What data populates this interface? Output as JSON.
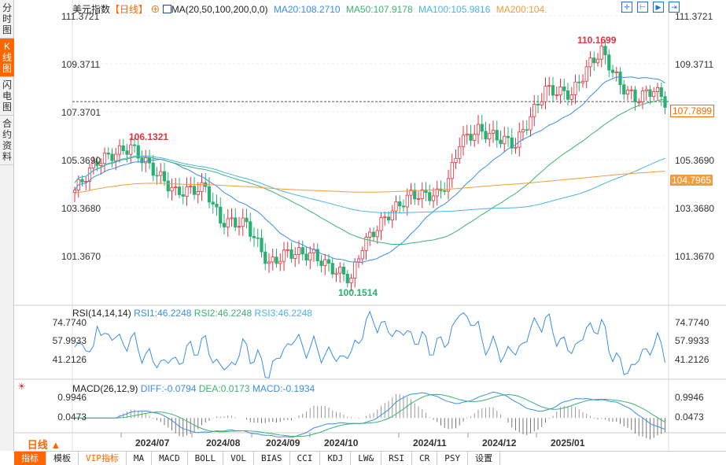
{
  "sidebar": {
    "tabs": [
      "分时图",
      "K线图",
      "闪电图",
      "合约资料"
    ],
    "active": 1
  },
  "header": {
    "symbol": "美元指数",
    "period": "【日线】",
    "ma_label": "MA(20,50,100,200,0,0)",
    "ma20": "MA20:108.2710",
    "ma50": "MA50:107.9178",
    "ma100": "MA100:105.9816",
    "ma200": "MA200:104."
  },
  "colors": {
    "up": "#e8313f",
    "down": "#27b072",
    "ma20": "#3a8ee6",
    "ma50": "#3cb371",
    "ma100": "#4ab4e6",
    "ma200": "#f39c3b",
    "accent": "#ff6600"
  },
  "price_axis": {
    "left": [
      "111.3721",
      "109.3711",
      "107.3701",
      "105.3690",
      "103.3680",
      "101.3670"
    ],
    "right": [
      "111.3721",
      "109.3711",
      "107.7899",
      "105.3690",
      "104.7965",
      "103.3680",
      "101.3670"
    ],
    "current": "107.7899",
    "ma200_tag": "104.7965"
  },
  "annotations": {
    "high1": "106.1321",
    "high2": "110.1699",
    "low": "100.1514"
  },
  "rsi": {
    "label": "RSI(14,14,14)",
    "rsi1": "RSI1:46.2248",
    "rsi2": "RSI2:46.2248",
    "rsi3": "RSI3:46.2248",
    "axis": [
      "74.7740",
      "57.9933",
      "41.2126"
    ]
  },
  "macd": {
    "label": "MACD(26,12,9)",
    "diff": "DIFF:-0.0794",
    "dea": "DEA:0.0173",
    "macd": "MACD:-0.1934",
    "axis": [
      "0.9946",
      "0.0473"
    ]
  },
  "dates": [
    "2024/07",
    "2024/08",
    "2024/09",
    "2024/10",
    "2024/11",
    "2024/12",
    "2025/01"
  ],
  "period_selector": "日线 ▲",
  "bottom_tabs": [
    "指标",
    "模板",
    "VIP指标",
    "MA",
    "MACD",
    "BOLL",
    "VOL",
    "BIAS",
    "CCI",
    "KDJ",
    "LW&",
    "RSI",
    "CR",
    "PSY",
    "设置"
  ],
  "price_anchors": [
    [
      0,
      104.1
    ],
    [
      6,
      105.3
    ],
    [
      15,
      105.9
    ],
    [
      20,
      105.1
    ],
    [
      27,
      104.0
    ],
    [
      35,
      104.2
    ],
    [
      39,
      102.8
    ],
    [
      46,
      102.7
    ],
    [
      52,
      101.0
    ],
    [
      57,
      101.5
    ],
    [
      64,
      101.4
    ],
    [
      68,
      100.9
    ],
    [
      74,
      100.4
    ],
    [
      77,
      101.8
    ],
    [
      84,
      103.1
    ],
    [
      90,
      103.9
    ],
    [
      97,
      103.9
    ],
    [
      100,
      104.5
    ],
    [
      103,
      106.1
    ],
    [
      108,
      106.6
    ],
    [
      113,
      106.3
    ],
    [
      118,
      106.0
    ],
    [
      126,
      108.3
    ],
    [
      133,
      108.1
    ],
    [
      138,
      109.4
    ],
    [
      141,
      109.9
    ],
    [
      146,
      108.5
    ],
    [
      150,
      107.9
    ],
    [
      155,
      108.3
    ],
    [
      158,
      107.8
    ]
  ]
}
